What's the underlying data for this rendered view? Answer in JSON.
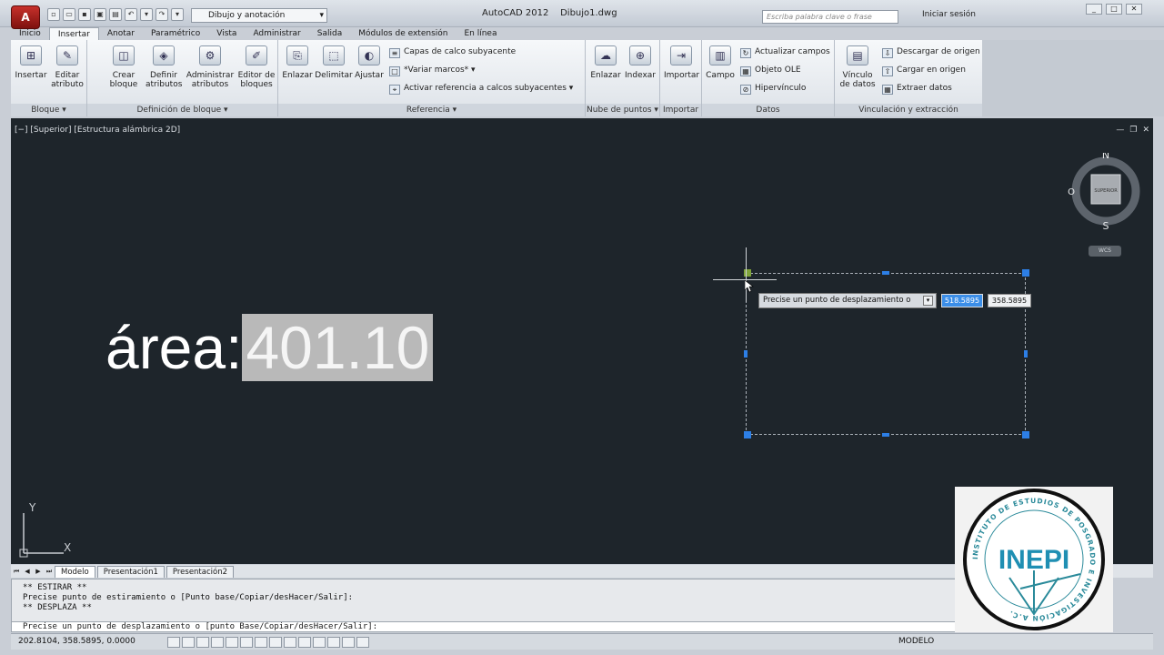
{
  "app": {
    "workspace": "Dibujo y anotación",
    "title": "AutoCAD 2012    Dibujo1.dwg",
    "search_placeholder": "Escriba palabra clave o frase",
    "login": "Iniciar sesión",
    "app_button": "A"
  },
  "tabs": [
    "Inicio",
    "Insertar",
    "Anotar",
    "Paramétrico",
    "Vista",
    "Administrar",
    "Salida",
    "Módulos de extensión",
    "En línea"
  ],
  "ribbon": {
    "bloque": {
      "label": "Bloque ▾",
      "insertar": "Insertar",
      "editar_1": "Editar",
      "editar_2": "atributo"
    },
    "definicion": {
      "label": "Definición de bloque ▾",
      "crear_1": "Crear",
      "crear_2": "bloque",
      "definir_1": "Definir",
      "definir_2": "atributos",
      "admin_1": "Administrar",
      "admin_2": "atributos",
      "editor_1": "Editor de",
      "editor_2": "bloques"
    },
    "referencia": {
      "label": "Referencia ▾",
      "enlazar": "Enlazar",
      "delimitar": "Delimitar",
      "ajustar": "Ajustar",
      "capas": "Capas de calco subyacente",
      "variar": "*Variar marcos* ▾",
      "activar": "Activar referencia a calcos subyacentes ▾"
    },
    "nube": {
      "label": "Nube de puntos ▾",
      "enlazar": "Enlazar",
      "indexar": "Indexar"
    },
    "importar": {
      "label": "Importar",
      "importar": "Importar"
    },
    "datos": {
      "label": "Datos",
      "campo": "Campo",
      "actualizar": "Actualizar campos",
      "ole": "Objeto OLE",
      "hipervinculo": "Hipervínculo"
    },
    "vinculacion": {
      "label": "Vinculación y extracción",
      "vinculo_1": "Vínculo",
      "vinculo_2": "de datos",
      "descargar": "Descargar de origen",
      "cargar": "Cargar en origen",
      "extraer": "Extraer  datos"
    }
  },
  "viewport": {
    "label": "[−] [Superior] [Estructura alámbrica 2D]",
    "min": "—",
    "restore": "❐",
    "close": "✕",
    "compass": {
      "n": "N",
      "s": "S",
      "o": "O",
      "top": "SUPERIOR",
      "wcs": "WCS"
    }
  },
  "drawing": {
    "area_label": "área:",
    "area_value": "401.10"
  },
  "dynamic_input": {
    "prompt": "Precise un punto de desplazamiento o",
    "value1": "518.5895",
    "value2": "358.5895"
  },
  "ucs": {
    "x": "X",
    "y": "Y"
  },
  "layout_tabs": [
    "Modelo",
    "Presentación1",
    "Presentación2"
  ],
  "command": {
    "lines": [
      "** ESTIRAR **",
      "Precise punto de estiramiento o [Punto base/Copiar/desHacer/Salir]:",
      "** DESPLAZA **"
    ],
    "current": "Precise un punto de desplazamiento o [punto Base/Copiar/desHacer/Salir]:"
  },
  "status": {
    "coords": "202.8104, 358.5895, 0.0000",
    "model": "MODELO"
  },
  "logo": {
    "text": "INEPI",
    "ring_text": "INSTITUTO DE ESTUDIOS DE POSGRADO E INVESTIGACIÓN A.C."
  }
}
